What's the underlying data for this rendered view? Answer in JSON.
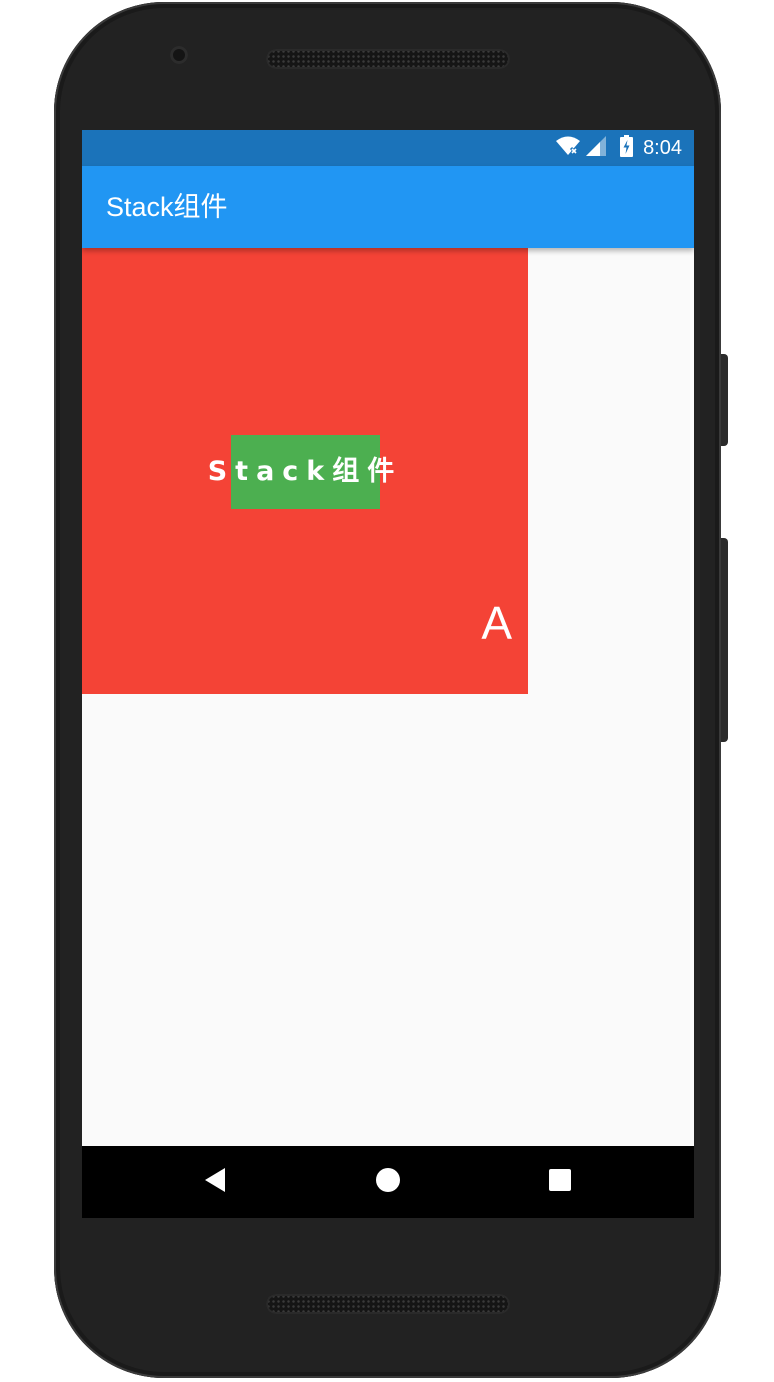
{
  "status_bar": {
    "time": "8:04",
    "icons": [
      "wifi-icon",
      "signal-icon",
      "battery-charging-icon"
    ],
    "color": "#1b73ba"
  },
  "app_bar": {
    "title": "Stack组件",
    "color": "#2196f3"
  },
  "stack": {
    "background_color": "#f44336",
    "overlay_color": "#4caf50",
    "center_text": "Stack组件",
    "corner_text": "A"
  },
  "nav_bar": {
    "buttons": [
      "back-icon",
      "home-icon",
      "recents-icon"
    ]
  }
}
